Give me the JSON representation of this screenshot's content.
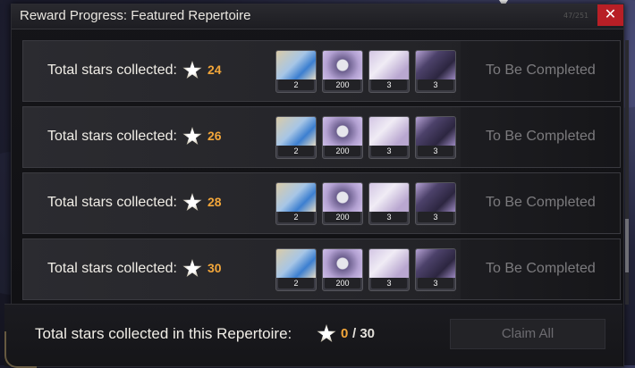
{
  "window": {
    "title": "Reward Progress: Featured Repertoire",
    "watermark": "47/251",
    "close_icon": "close-icon"
  },
  "rows": [
    {
      "label": "Total stars collected:",
      "stars_required": "24",
      "rewards": [
        "2",
        "200",
        "3",
        "3"
      ],
      "status": "To Be Completed"
    },
    {
      "label": "Total stars collected:",
      "stars_required": "26",
      "rewards": [
        "2",
        "200",
        "3",
        "3"
      ],
      "status": "To Be Completed"
    },
    {
      "label": "Total stars collected:",
      "stars_required": "28",
      "rewards": [
        "2",
        "200",
        "3",
        "3"
      ],
      "status": "To Be Completed"
    },
    {
      "label": "Total stars collected:",
      "stars_required": "30",
      "rewards": [
        "2",
        "200",
        "3",
        "3"
      ],
      "status": "To Be Completed"
    }
  ],
  "reward_icons": [
    "character-icon",
    "disc-icon",
    "letter-icon",
    "book-icon"
  ],
  "footer": {
    "label": "Total stars collected in this Repertoire:",
    "current": "0",
    "total": "/ 30",
    "claim_all": "Claim All"
  },
  "colors": {
    "accent": "#f2a63a",
    "close": "#b81f26"
  }
}
